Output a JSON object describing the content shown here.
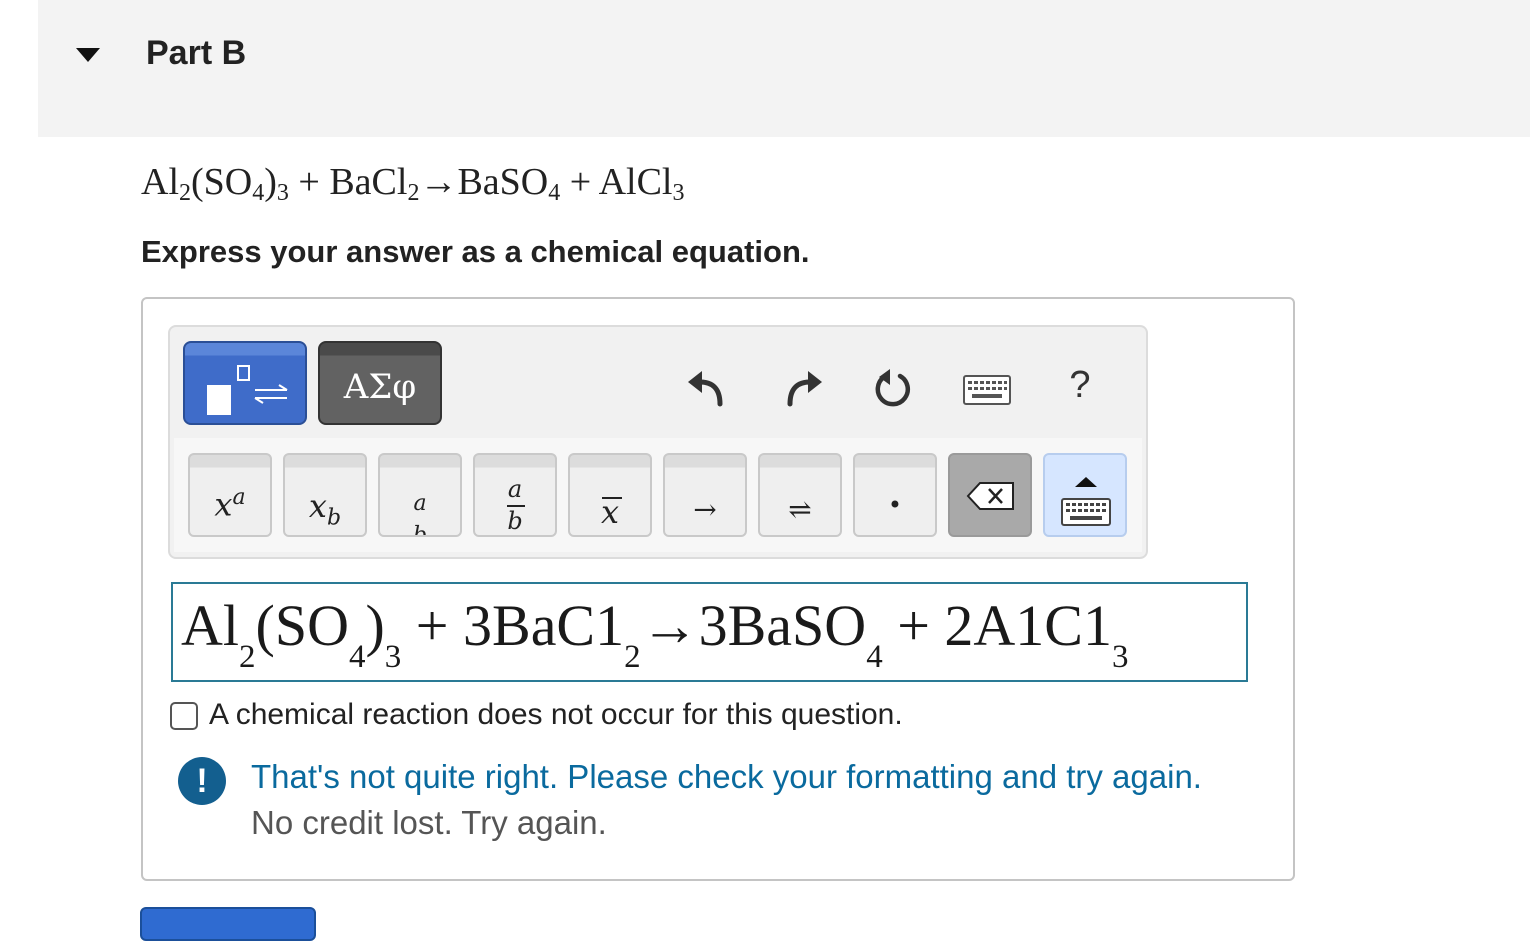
{
  "part": {
    "title": "Part B"
  },
  "problem": {
    "equation": [
      {
        "t": "Al"
      },
      {
        "sub": "2"
      },
      {
        "t": "(SO"
      },
      {
        "sub": "4"
      },
      {
        "t": ")"
      },
      {
        "sub": "3"
      },
      {
        "t": " + BaCl"
      },
      {
        "sub": "2"
      },
      {
        "t": "→BaSO"
      },
      {
        "sub": "4"
      },
      {
        "t": " + AlCl"
      },
      {
        "sub": "3"
      }
    ],
    "instruction": "Express your answer as a chemical equation."
  },
  "toolbar": {
    "symbols_label": "ΑΣφ",
    "help_label": "?"
  },
  "keypad": {
    "superscript": {
      "base": "x",
      "exp": "a"
    },
    "subscript": {
      "base": "x",
      "sub": "b"
    },
    "fraction_small": {
      "num": "a",
      "den": "b"
    },
    "fraction": {
      "num": "a",
      "den": "b"
    },
    "overline_x": "x",
    "arrow": "→",
    "equilibrium": "⇌",
    "dot": "•"
  },
  "answer": {
    "equation": [
      {
        "t": "Al"
      },
      {
        "sub": "2"
      },
      {
        "t": "(SO"
      },
      {
        "sub": "4"
      },
      {
        "t": ")"
      },
      {
        "sub": "3"
      },
      {
        "t": " + 3BaC1"
      },
      {
        "sub": "2"
      },
      {
        "t": "→3BaSO"
      },
      {
        "sub": "4"
      },
      {
        "t": " + 2A1C1"
      },
      {
        "sub": "3"
      }
    ]
  },
  "no_reaction": {
    "label": "A chemical reaction does not occur for this question.",
    "checked": false
  },
  "feedback": {
    "message": "That's not quite right. Please check your formatting and try again.",
    "sub_message": "No credit lost. Try again.",
    "icon": "!"
  },
  "colors": {
    "accent": "#2a7a95",
    "feedback": "#0a6a9e",
    "primary_button": "#2f6bd1"
  }
}
